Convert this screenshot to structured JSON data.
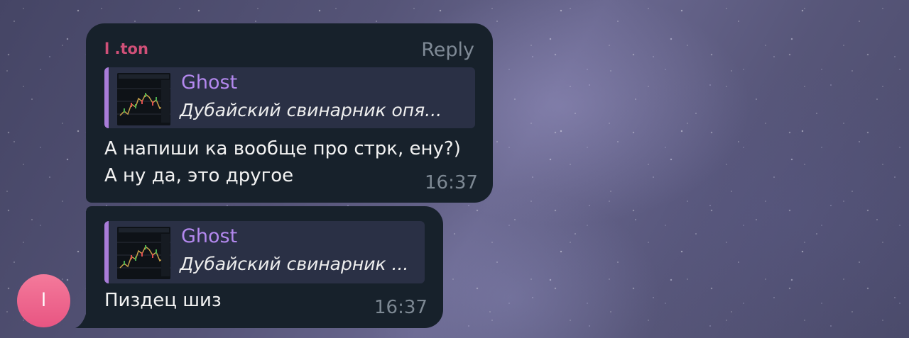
{
  "messages": [
    {
      "sender": "l .ton",
      "reply_action": "Reply",
      "quote": {
        "author": "Ghost",
        "text": "Дубайский свинарник опя..."
      },
      "lines": [
        "А напиши ка вообще про стрк, ену?)",
        "А ну да, это другое"
      ],
      "time": "16:37"
    },
    {
      "quote": {
        "author": "Ghost",
        "text": "Дубайский свинарник ..."
      },
      "lines": [
        "Пиздец шиз"
      ],
      "time": "16:37"
    }
  ],
  "avatar": {
    "initial": "l"
  },
  "colors": {
    "bubble": "#17212b",
    "quote_bar": "#a97cd9",
    "quote_author": "#b388ee",
    "sender": "#d05078",
    "avatar": "#ee6a8e"
  }
}
